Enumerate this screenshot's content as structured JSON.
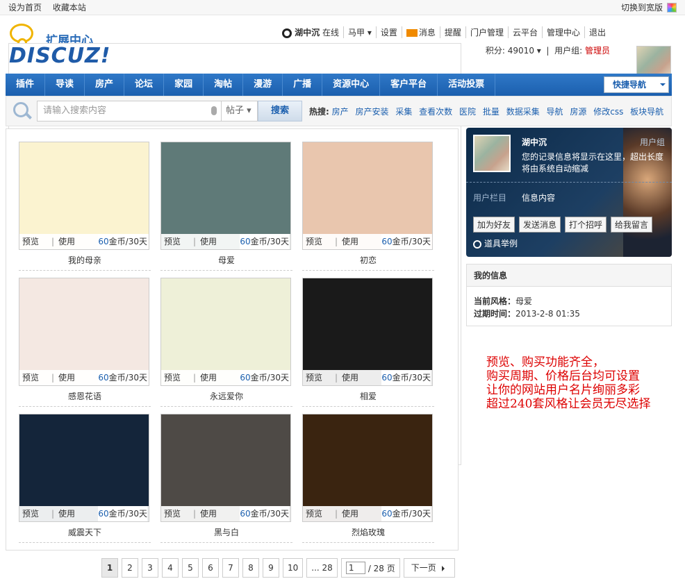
{
  "topbar": {
    "set_home": "设为首页",
    "bookmark": "收藏本站",
    "switch_wide": "切换到宽版"
  },
  "logo": {
    "subtitle": "扩展中心",
    "brand": "DISCUZ!"
  },
  "user": {
    "name": "湖中沉",
    "status": "在线",
    "horse": "马甲",
    "settings": "设置",
    "messages": "消息",
    "remind": "提醒",
    "portal": "门户管理",
    "cloud": "云平台",
    "admin_center": "管理中心",
    "logout": "退出",
    "points_label": "积分: 49010",
    "group_label": "用户组:",
    "group": "管理员"
  },
  "nav": {
    "items": [
      "插件",
      "导读",
      "房产",
      "论坛",
      "家园",
      "淘帖",
      "漫游",
      "广播",
      "资源中心",
      "客户平台",
      "活动投票"
    ],
    "quick": "快捷导航"
  },
  "search": {
    "placeholder": "请输入搜索内容",
    "scope": "帖子",
    "button": "搜索",
    "hot_label": "热搜:",
    "hot": [
      "房产",
      "房产安装",
      "采集",
      "查看次数",
      "医院",
      "批量",
      "数据采集",
      "导航",
      "房源",
      "修改css",
      "板块导航"
    ]
  },
  "cards": [
    {
      "name": "我的母亲",
      "preview": "预览",
      "use": "使用",
      "price": "60",
      "unit": "金币/30天"
    },
    {
      "name": "母爱",
      "preview": "预览",
      "use": "使用",
      "price": "60",
      "unit": "金币/30天"
    },
    {
      "name": "初恋",
      "preview": "预览",
      "use": "使用",
      "price": "60",
      "unit": "金币/30天"
    },
    {
      "name": "感恩花语",
      "preview": "预览",
      "use": "使用",
      "price": "60",
      "unit": "金币/30天"
    },
    {
      "name": "永远爱你",
      "preview": "预览",
      "use": "使用",
      "price": "60",
      "unit": "金币/30天"
    },
    {
      "name": "相爱",
      "preview": "预览",
      "use": "使用",
      "price": "60",
      "unit": "金币/30天"
    },
    {
      "name": "威震天下",
      "preview": "预览",
      "use": "使用",
      "price": "60",
      "unit": "金币/30天"
    },
    {
      "name": "黑与白",
      "preview": "预览",
      "use": "使用",
      "price": "60",
      "unit": "金币/30天"
    },
    {
      "name": "烈焰玫瑰",
      "preview": "预览",
      "use": "使用",
      "price": "60",
      "unit": "金币/30天"
    }
  ],
  "card_colors": [
    "#fbf3d0",
    "#5f7a78",
    "#e9c6ae",
    "#f4e8e2",
    "#eef0d8",
    "#1a1a1a",
    "#14253a",
    "#4e4a46",
    "#3a2410"
  ],
  "profile": {
    "name": "湖中沉",
    "group": "用户组",
    "desc": "您的记录信息将显示在这里，超出长度将由系统自动缩减",
    "col": "用户栏目",
    "info": "信息内容",
    "btns": [
      "加为好友",
      "发送消息",
      "打个招呼",
      "给我留言"
    ],
    "tool": "道具举例"
  },
  "myinfo": {
    "title": "我的信息",
    "style_label": "当前风格：",
    "style": "母爱",
    "expire_label": "过期时间：",
    "expire": "2013-2-8 01:35"
  },
  "promo": [
    "预览、购买功能齐全，",
    "购买周期、价格后台均可设置",
    "让你的网站用户名片绚丽多彩",
    "超过240套风格让会员无尽选择"
  ],
  "pager": {
    "pages": [
      "1",
      "2",
      "3",
      "4",
      "5",
      "6",
      "7",
      "8",
      "9",
      "10",
      "... 28"
    ],
    "current": "1",
    "total": "/ 28 页",
    "next": "下一页"
  }
}
